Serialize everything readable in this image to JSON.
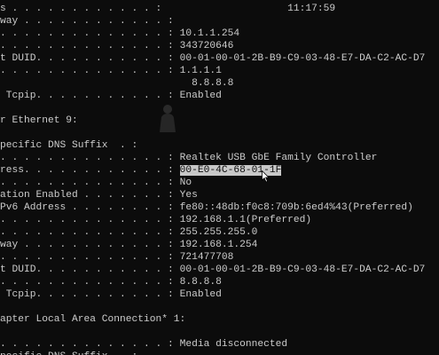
{
  "terminal": {
    "lines": [
      {
        "prefix": "s . . . . . . . . . . . . :",
        "value": "11:17:59",
        "value_sep": "                    "
      },
      {
        "prefix": "way . . . . . . . . . . . . :",
        "value": ""
      },
      {
        "prefix": ". . . . . . . . . . . . . . :",
        "value": "10.1.1.254"
      },
      {
        "prefix": ". . . . . . . . . . . . . . :",
        "value": "343720646"
      },
      {
        "prefix": "t DUID. . . . . . . . . . . :",
        "value": "00-01-00-01-2B-B9-C9-03-48-E7-DA-C2-AC-D7"
      },
      {
        "prefix": ". . . . . . . . . . . . . . :",
        "value": "1.1.1.1"
      },
      {
        "prefix": "                               ",
        "value": "8.8.8.8"
      },
      {
        "prefix": " Tcpip. . . . . . . . . . . :",
        "value": "Enabled"
      },
      {
        "prefix": "",
        "value": ""
      },
      {
        "prefix": "r Ethernet 9:",
        "value": ""
      },
      {
        "prefix": "",
        "value": ""
      },
      {
        "prefix": "pecific DNS Suffix  . :",
        "value": ""
      },
      {
        "prefix": ". . . . . . . . . . . . . . :",
        "value": "Realtek USB GbE Family Controller"
      },
      {
        "prefix": "ress. . . . . . . . . . . . :",
        "value": "00-E0-4C-68-01-1F",
        "selected": true
      },
      {
        "prefix": ". . . . . . . . . . . . . . :",
        "value": "No"
      },
      {
        "prefix": "ation Enabled . . . . . . . :",
        "value": "Yes"
      },
      {
        "prefix": "Pv6 Address . . . . . . . . :",
        "value": "fe80::48db:f0c8:709b:6ed4%43(Preferred)"
      },
      {
        "prefix": ". . . . . . . . . . . . . . :",
        "value": "192.168.1.1(Preferred)"
      },
      {
        "prefix": ". . . . . . . . . . . . . . :",
        "value": "255.255.255.0"
      },
      {
        "prefix": "way . . . . . . . . . . . . :",
        "value": "192.168.1.254"
      },
      {
        "prefix": ". . . . . . . . . . . . . . :",
        "value": "721477708"
      },
      {
        "prefix": "t DUID. . . . . . . . . . . :",
        "value": "00-01-00-01-2B-B9-C9-03-48-E7-DA-C2-AC-D7"
      },
      {
        "prefix": ". . . . . . . . . . . . . . :",
        "value": "8.8.8.8"
      },
      {
        "prefix": " Tcpip. . . . . . . . . . . :",
        "value": "Enabled"
      },
      {
        "prefix": "",
        "value": ""
      },
      {
        "prefix": "apter Local Area Connection* 1:",
        "value": ""
      },
      {
        "prefix": "",
        "value": ""
      },
      {
        "prefix": ". . . . . . . . . . . . . . :",
        "value": "Media disconnected"
      },
      {
        "prefix": "pecific DNS Suffix  . :",
        "value": ""
      }
    ]
  },
  "colors": {
    "background": "#0c0c0c",
    "text": "#cccccc",
    "selection_bg": "#c8c8c8",
    "selection_text": "#0c0c0c"
  },
  "icons": {
    "overlay": "faded-person-icon",
    "pointer": "mouse-pointer-icon"
  }
}
